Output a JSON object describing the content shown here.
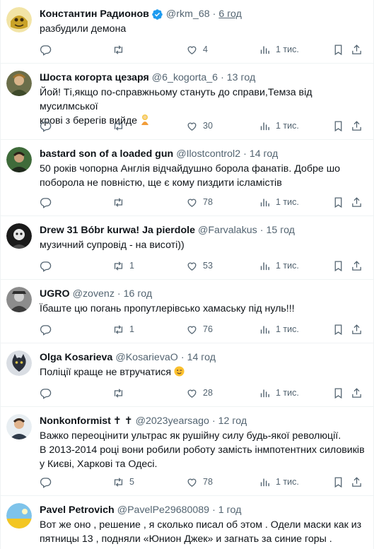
{
  "tweets": [
    {
      "name": "Константин Радионов",
      "handle": "@rkm_68",
      "time": "6 год",
      "text": [
        "разбудили демона"
      ],
      "replies": "",
      "retweets": "",
      "likes": "4",
      "views": "1 тис."
    },
    {
      "name": "Шоста когорта цезаря",
      "handle": "@6_kogorta_6",
      "time": "13 год",
      "text": [
        "Йой! Ті,якщо по-справжньому стануть до справи,Темза від мусилмської",
        "крові з берегів вийде"
      ],
      "replies": "",
      "retweets": "",
      "likes": "30",
      "views": "1 тис."
    },
    {
      "name": "bastard son of a loaded gun",
      "handle": "@Ilostcontrol2",
      "time": "14 год",
      "text": [
        "50 років чопорна Англія відчайдушно борола фанатів. Добре шо",
        "поборола не повністю, ще є кому пиздити ісламістів"
      ],
      "replies": "",
      "retweets": "",
      "likes": "78",
      "views": "1 тис."
    },
    {
      "name": "Drew 31 Bóbr kurwa! Ja pierdole",
      "handle": "@Farvalakus",
      "time": "15 год",
      "text": [
        "музичний супровід - на висоті))"
      ],
      "replies": "",
      "retweets": "1",
      "likes": "53",
      "views": "1 тис."
    },
    {
      "name": "UGRO",
      "handle": "@zovenz",
      "time": "16 год",
      "text": [
        "Їбаште цю погань пропутлерівсько хамаську під нуль!!!"
      ],
      "replies": "",
      "retweets": "1",
      "likes": "76",
      "views": "1 тис."
    },
    {
      "name": "Olga Kosarieva",
      "handle": "@KosarievaO",
      "time": "14 год",
      "text": [
        "Поліції краще не втручатися"
      ],
      "replies": "",
      "retweets": "",
      "likes": "28",
      "views": "1 тис."
    },
    {
      "name": "Nonkonformist",
      "name_suffix": "✝ ✝",
      "handle": "@2023yearsago",
      "time": "12 год",
      "text": [
        "Важко переоцінити ультрас як рушійну силу будь-якої революції.",
        "В 2013-2014 році вони робили роботу замість інмпотентних силовиків",
        "у Києві, Харкові та Одесі."
      ],
      "replies": "",
      "retweets": "5",
      "likes": "78",
      "views": "1 тис."
    },
    {
      "name": "Pavel Petrovich",
      "handle": "@PavelPe29680089",
      "time": "1 год",
      "text": [
        "Вот же оно , решение , я сколько писал об этом . Одели маски как из",
        "пятницы 13 , подняли  «Юнион Джек» и загнать за синие горы ."
      ]
    }
  ],
  "colors": {
    "text": "#0f1419",
    "secondary": "#536471",
    "verified": "#1d9bf0",
    "divider": "#eff3f4"
  }
}
